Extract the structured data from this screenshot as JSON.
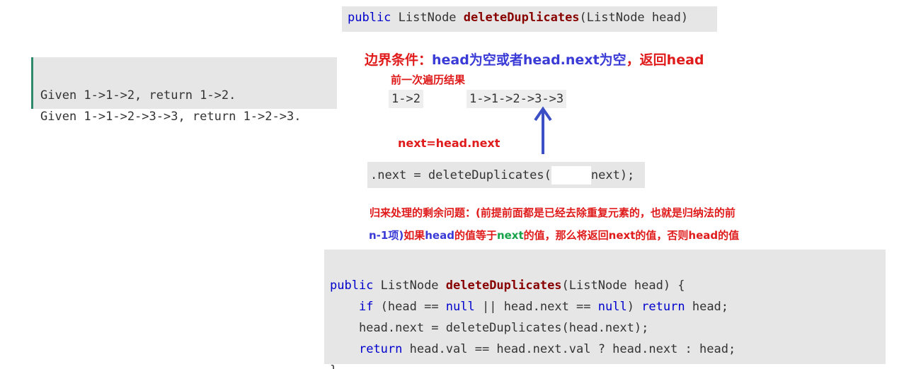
{
  "signature_code": {
    "kw_public": "public",
    "type": " ListNode ",
    "fn_name": "deleteDuplicates",
    "params": "(ListNode head)"
  },
  "examples": {
    "line1": "Given 1->1->2, return 1->2.",
    "line2": "Given 1->1->2->3->3, return 1->2->3."
  },
  "edge_condition": {
    "label": "边界条件：",
    "head_null": "head为空或者head.next为空",
    "comma": "，",
    "return_head": "返回head"
  },
  "previous_result": {
    "label": "前一次遍历结果",
    "result1": "1->2",
    "result2": "1->1->2->3->3"
  },
  "next_assignment_label": "next=head.next",
  "assign_code": {
    "lhs": ".next = deleteDuplicates(",
    "rhs": "next);"
  },
  "recursion_note": {
    "line1": "归来处理的剩余问题：(前提前面都是已经去除重复元素的，也就是归纳法的前",
    "line2_a": "n-1项)",
    "line2_b": "如果",
    "line2_c": "head",
    "line2_d": "的值等于",
    "line2_e": "next",
    "line2_f": "的值，那么将返回",
    "line2_g": "next",
    "line2_h": "的值，否则",
    "line2_i": "head",
    "line2_j": "的值"
  },
  "implementation_code": {
    "l1_kw": "public",
    "l1_type": " ListNode ",
    "l1_fn": "deleteDuplicates",
    "l1_rest": "(ListNode head) {",
    "l2_indent": "    ",
    "l2_if": "if",
    "l2_a": " (head == ",
    "l2_null1": "null",
    "l2_b": " || head.next == ",
    "l2_null2": "null",
    "l2_c": ") ",
    "l2_return": "return",
    "l2_d": " head;",
    "l3": "    head.next = deleteDuplicates(head.next);",
    "l4_indent": "    ",
    "l4_return": "return",
    "l4_rest": " head.val == head.next.val ? head.next : head;",
    "l5": "}"
  },
  "colors": {
    "keyword": "#0000cc",
    "function": "#880000",
    "annotation_red": "#e01b1b",
    "annotation_blue": "#3a3ad6",
    "annotation_green": "#16a34a",
    "arrow": "#3d4fc4",
    "quote_border": "#2f8a6b"
  },
  "icons": {
    "up_arrow": "arrow-up-icon"
  }
}
